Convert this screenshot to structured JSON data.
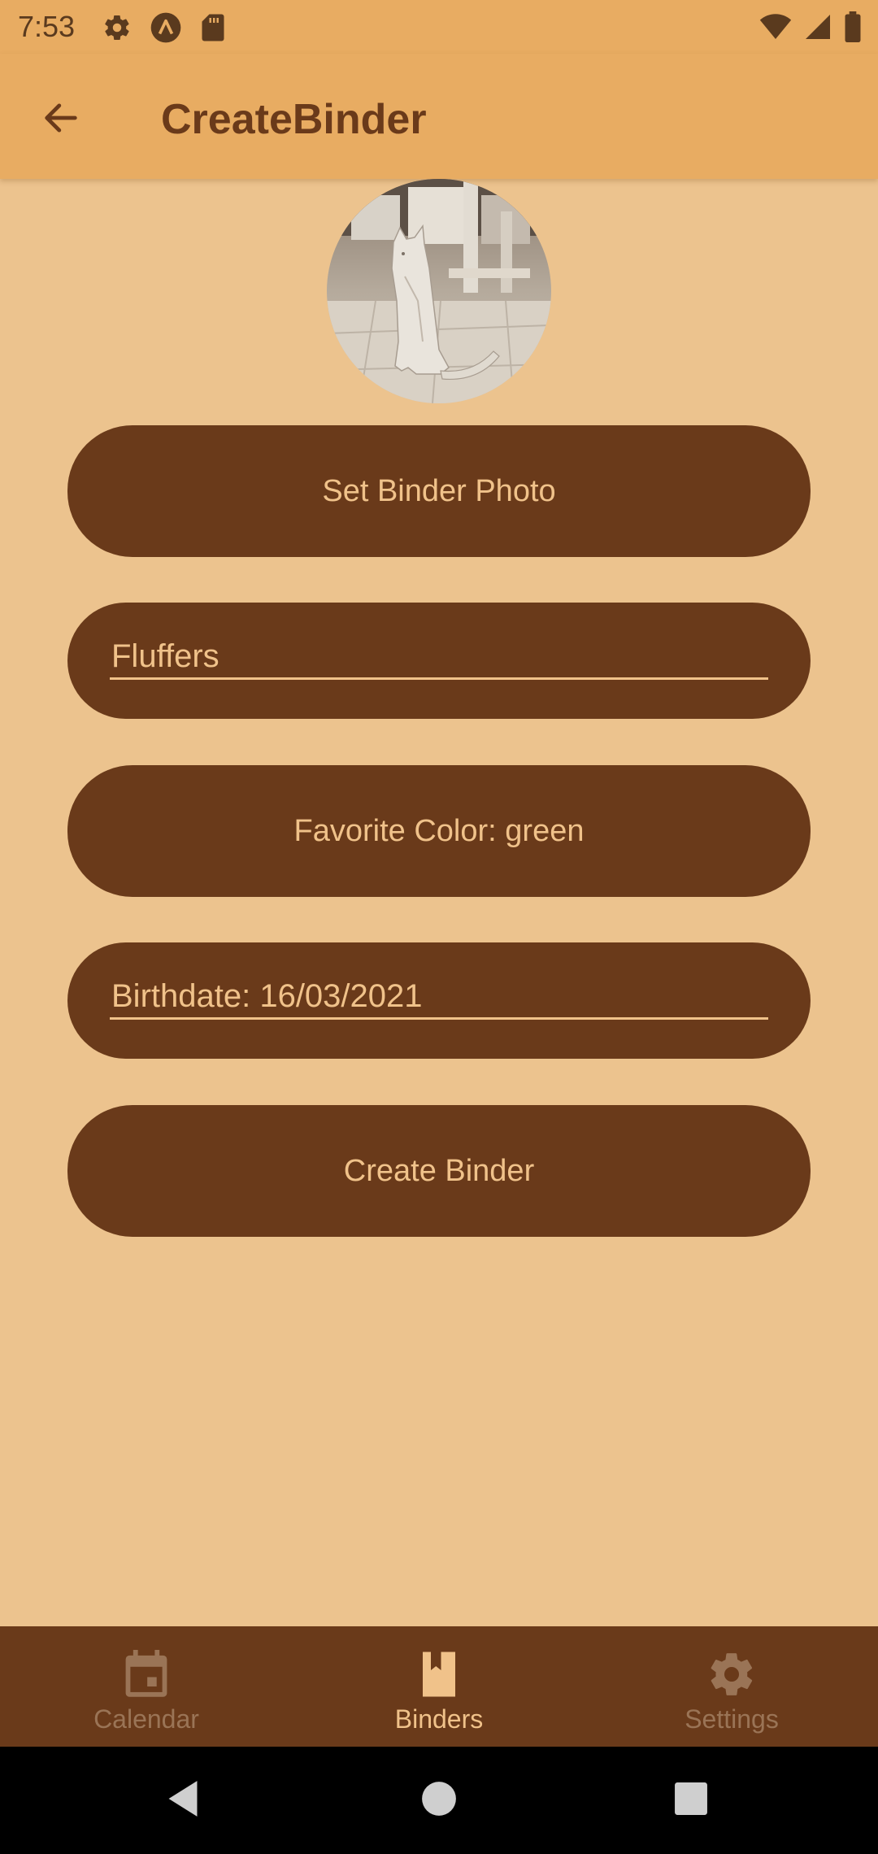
{
  "status_bar": {
    "time": "7:53",
    "icons_left": [
      "gear-icon",
      "a-logo-icon",
      "sd-card-icon"
    ],
    "icons_right": [
      "wifi-icon",
      "signal-icon",
      "battery-icon"
    ]
  },
  "app_bar": {
    "title": "CreateBinder",
    "back_icon": "arrow-left-icon"
  },
  "binder_photo": {
    "subject": "cat photo"
  },
  "form": {
    "set_photo_label": "Set Binder Photo",
    "name_value": "Fluffers",
    "favorite_color_label": "Favorite Color: green",
    "birthdate_value": "Birthdate: 16/03/2021",
    "create_label": "Create Binder"
  },
  "bottom_nav": {
    "items": [
      {
        "label": "Calendar",
        "icon": "calendar-icon",
        "active": false
      },
      {
        "label": "Binders",
        "icon": "binder-icon",
        "active": true
      },
      {
        "label": "Settings",
        "icon": "gear-icon",
        "active": false
      }
    ]
  },
  "system_nav": {
    "icons": [
      "back-triangle-icon",
      "home-circle-icon",
      "recents-square-icon"
    ]
  },
  "colors": {
    "app_bar": "#E8AC62",
    "background": "#ECC38E",
    "primary_dark": "#6A3A1A",
    "on_primary": "#F0C28A",
    "nav_inactive": "#9A7456"
  }
}
